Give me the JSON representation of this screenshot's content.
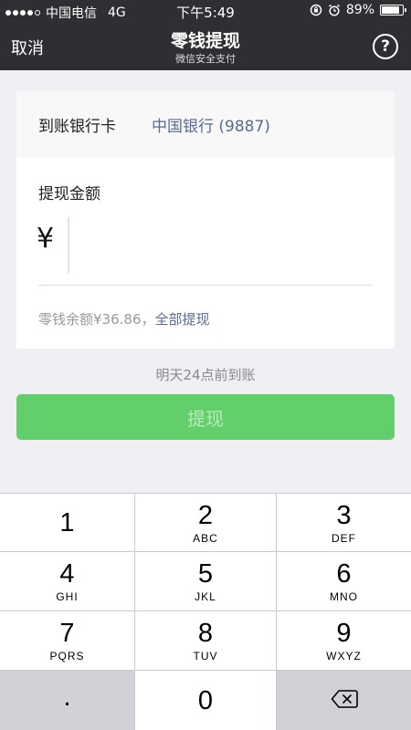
{
  "status_bar": {
    "carrier": "中国电信",
    "network": "4G",
    "time": "下午5:49",
    "battery": "89%",
    "battery_level": 0.89
  },
  "nav": {
    "cancel_label": "取消",
    "title": "零钱提现",
    "subtitle": "微信安全支付",
    "help_label": "?"
  },
  "bank": {
    "label": "到账银行卡",
    "value": "中国银行 (9887)"
  },
  "amount": {
    "label": "提现金额",
    "currency_symbol": "¥",
    "input_value": "",
    "balance_text": "零钱余额¥36.86，",
    "withdraw_all_label": "全部提现"
  },
  "arrival_note": "明天24点前到账",
  "withdraw_button_label": "提现",
  "keypad": {
    "keys": [
      {
        "num": "1",
        "letters": ""
      },
      {
        "num": "2",
        "letters": "ABC"
      },
      {
        "num": "3",
        "letters": "DEF"
      },
      {
        "num": "4",
        "letters": "GHI"
      },
      {
        "num": "5",
        "letters": "JKL"
      },
      {
        "num": "6",
        "letters": "MNO"
      },
      {
        "num": "7",
        "letters": "PQRS"
      },
      {
        "num": "8",
        "letters": "TUV"
      },
      {
        "num": "9",
        "letters": "WXYZ"
      },
      {
        "num": ".",
        "letters": ""
      },
      {
        "num": "0",
        "letters": ""
      }
    ],
    "delete_icon": "backspace-icon"
  },
  "colors": {
    "nav_background": "#2e2e33",
    "link_blue": "#576b95",
    "button_green": "#62cf6a"
  }
}
